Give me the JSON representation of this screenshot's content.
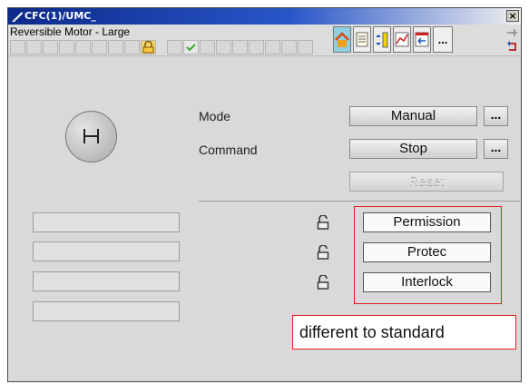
{
  "window": {
    "title": "CFC(1)/UMC_",
    "close_label": "×"
  },
  "header": {
    "subtitle": "Reversible Motor - Large",
    "more_label": "..."
  },
  "main": {
    "mode_label": "Mode",
    "command_label": "Command",
    "mode_value": "Manual",
    "command_value": "Stop",
    "reset_label": "Reset",
    "dots": "..."
  },
  "protection": {
    "buttons": [
      "Permission",
      "Protec",
      "Interlock"
    ]
  },
  "note": "different to standard",
  "colors": {
    "highlight": "#e02020",
    "title_bar": "#0c2a8a"
  }
}
